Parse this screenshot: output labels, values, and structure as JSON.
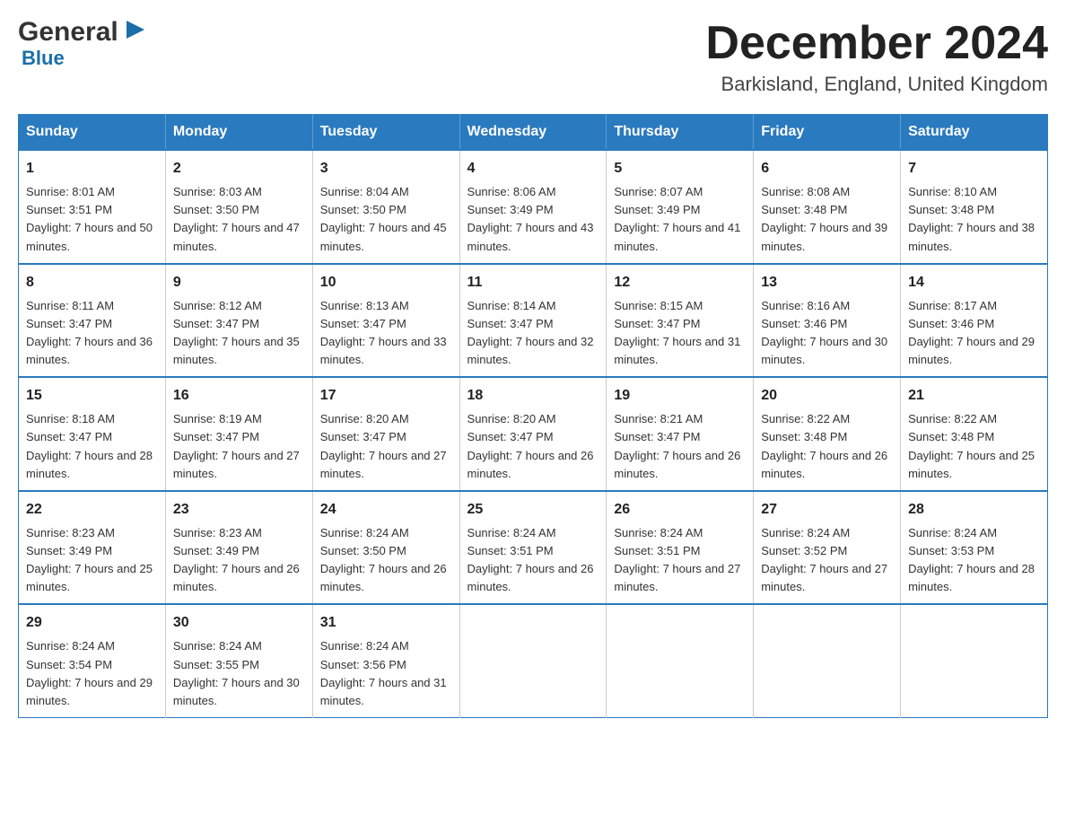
{
  "header": {
    "logo_general": "General",
    "logo_blue": "Blue",
    "title": "December 2024",
    "location": "Barkisland, England, United Kingdom"
  },
  "calendar": {
    "days": [
      "Sunday",
      "Monday",
      "Tuesday",
      "Wednesday",
      "Thursday",
      "Friday",
      "Saturday"
    ],
    "weeks": [
      [
        {
          "day": "1",
          "sunrise": "8:01 AM",
          "sunset": "3:51 PM",
          "daylight": "7 hours and 50 minutes."
        },
        {
          "day": "2",
          "sunrise": "8:03 AM",
          "sunset": "3:50 PM",
          "daylight": "7 hours and 47 minutes."
        },
        {
          "day": "3",
          "sunrise": "8:04 AM",
          "sunset": "3:50 PM",
          "daylight": "7 hours and 45 minutes."
        },
        {
          "day": "4",
          "sunrise": "8:06 AM",
          "sunset": "3:49 PM",
          "daylight": "7 hours and 43 minutes."
        },
        {
          "day": "5",
          "sunrise": "8:07 AM",
          "sunset": "3:49 PM",
          "daylight": "7 hours and 41 minutes."
        },
        {
          "day": "6",
          "sunrise": "8:08 AM",
          "sunset": "3:48 PM",
          "daylight": "7 hours and 39 minutes."
        },
        {
          "day": "7",
          "sunrise": "8:10 AM",
          "sunset": "3:48 PM",
          "daylight": "7 hours and 38 minutes."
        }
      ],
      [
        {
          "day": "8",
          "sunrise": "8:11 AM",
          "sunset": "3:47 PM",
          "daylight": "7 hours and 36 minutes."
        },
        {
          "day": "9",
          "sunrise": "8:12 AM",
          "sunset": "3:47 PM",
          "daylight": "7 hours and 35 minutes."
        },
        {
          "day": "10",
          "sunrise": "8:13 AM",
          "sunset": "3:47 PM",
          "daylight": "7 hours and 33 minutes."
        },
        {
          "day": "11",
          "sunrise": "8:14 AM",
          "sunset": "3:47 PM",
          "daylight": "7 hours and 32 minutes."
        },
        {
          "day": "12",
          "sunrise": "8:15 AM",
          "sunset": "3:47 PM",
          "daylight": "7 hours and 31 minutes."
        },
        {
          "day": "13",
          "sunrise": "8:16 AM",
          "sunset": "3:46 PM",
          "daylight": "7 hours and 30 minutes."
        },
        {
          "day": "14",
          "sunrise": "8:17 AM",
          "sunset": "3:46 PM",
          "daylight": "7 hours and 29 minutes."
        }
      ],
      [
        {
          "day": "15",
          "sunrise": "8:18 AM",
          "sunset": "3:47 PM",
          "daylight": "7 hours and 28 minutes."
        },
        {
          "day": "16",
          "sunrise": "8:19 AM",
          "sunset": "3:47 PM",
          "daylight": "7 hours and 27 minutes."
        },
        {
          "day": "17",
          "sunrise": "8:20 AM",
          "sunset": "3:47 PM",
          "daylight": "7 hours and 27 minutes."
        },
        {
          "day": "18",
          "sunrise": "8:20 AM",
          "sunset": "3:47 PM",
          "daylight": "7 hours and 26 minutes."
        },
        {
          "day": "19",
          "sunrise": "8:21 AM",
          "sunset": "3:47 PM",
          "daylight": "7 hours and 26 minutes."
        },
        {
          "day": "20",
          "sunrise": "8:22 AM",
          "sunset": "3:48 PM",
          "daylight": "7 hours and 26 minutes."
        },
        {
          "day": "21",
          "sunrise": "8:22 AM",
          "sunset": "3:48 PM",
          "daylight": "7 hours and 25 minutes."
        }
      ],
      [
        {
          "day": "22",
          "sunrise": "8:23 AM",
          "sunset": "3:49 PM",
          "daylight": "7 hours and 25 minutes."
        },
        {
          "day": "23",
          "sunrise": "8:23 AM",
          "sunset": "3:49 PM",
          "daylight": "7 hours and 26 minutes."
        },
        {
          "day": "24",
          "sunrise": "8:24 AM",
          "sunset": "3:50 PM",
          "daylight": "7 hours and 26 minutes."
        },
        {
          "day": "25",
          "sunrise": "8:24 AM",
          "sunset": "3:51 PM",
          "daylight": "7 hours and 26 minutes."
        },
        {
          "day": "26",
          "sunrise": "8:24 AM",
          "sunset": "3:51 PM",
          "daylight": "7 hours and 27 minutes."
        },
        {
          "day": "27",
          "sunrise": "8:24 AM",
          "sunset": "3:52 PM",
          "daylight": "7 hours and 27 minutes."
        },
        {
          "day": "28",
          "sunrise": "8:24 AM",
          "sunset": "3:53 PM",
          "daylight": "7 hours and 28 minutes."
        }
      ],
      [
        {
          "day": "29",
          "sunrise": "8:24 AM",
          "sunset": "3:54 PM",
          "daylight": "7 hours and 29 minutes."
        },
        {
          "day": "30",
          "sunrise": "8:24 AM",
          "sunset": "3:55 PM",
          "daylight": "7 hours and 30 minutes."
        },
        {
          "day": "31",
          "sunrise": "8:24 AM",
          "sunset": "3:56 PM",
          "daylight": "7 hours and 31 minutes."
        },
        null,
        null,
        null,
        null
      ]
    ]
  }
}
